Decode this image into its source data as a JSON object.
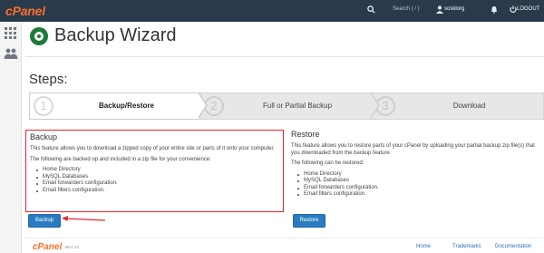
{
  "topbar": {
    "brand": "cPanel",
    "search_label": "Search ( / )",
    "username": "sosklorg",
    "logout_label": "LOGOUT"
  },
  "page": {
    "title": "Backup Wizard",
    "steps_heading": "Steps:"
  },
  "steps": [
    {
      "number": "1",
      "label": "Backup/Restore",
      "active": true
    },
    {
      "number": "2",
      "label": "Full or Partial Backup",
      "active": false
    },
    {
      "number": "3",
      "label": "Download",
      "active": false
    }
  ],
  "backup": {
    "heading": "Backup",
    "description": "This feature allows you to download a zipped copy of your entire site or parts of it onto your computer.",
    "intro": "The following are backed up and included in a zip file for your convenience:",
    "items": [
      "Home Directory",
      "MySQL Databases",
      "Email forwarders configuration.",
      "Email filters configuration."
    ],
    "button_label": "Backup"
  },
  "restore": {
    "heading": "Restore",
    "description": "This feature allows you to restore parts of your cPanel by uploading your partial backup zip file(s) that you downloaded from the backup feature.",
    "intro": "The following can be restored:",
    "items": [
      "Home Directory",
      "MySQL Databases",
      "Email forwarders configuration.",
      "Email filters configuration."
    ],
    "button_label": "Restore"
  },
  "footer": {
    "brand": "cPanel",
    "version": "90.0.24",
    "links": [
      "Home",
      "Trademarks",
      "Documentation"
    ]
  },
  "colors": {
    "topbar": "#293a4a",
    "brand_orange": "#ff6c2c",
    "button_blue": "#2a7bc0",
    "highlight_red": "#e0262d"
  }
}
